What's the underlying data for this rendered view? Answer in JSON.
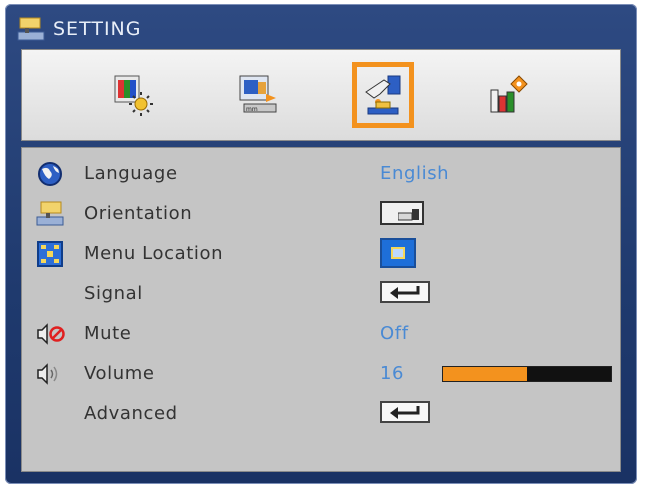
{
  "window": {
    "title": "SETTING",
    "title_icon": "projector-setting-icon"
  },
  "tabs": [
    {
      "icon": "image-settings-icon",
      "active": false
    },
    {
      "icon": "display-settings-icon",
      "active": false
    },
    {
      "icon": "setup-hand-icon",
      "active": true
    },
    {
      "icon": "options-bars-icon",
      "active": false
    }
  ],
  "menu": {
    "language": {
      "label": "Language",
      "value": "English",
      "icon": "globe-icon"
    },
    "orientation": {
      "label": "Orientation",
      "icon": "projector-orientation-icon",
      "value_icon": "front-projection-icon"
    },
    "menu_location": {
      "label": "Menu Location",
      "icon": "menu-location-icon",
      "value_icon": "center-location-icon"
    },
    "signal": {
      "label": "Signal",
      "value_icon": "enter-icon"
    },
    "mute": {
      "label": "Mute",
      "value": "Off",
      "icon": "mute-speaker-icon"
    },
    "volume": {
      "label": "Volume",
      "value": "16",
      "icon": "speaker-icon",
      "level": 0.5
    },
    "advanced": {
      "label": "Advanced",
      "value_icon": "enter-icon"
    }
  },
  "colors": {
    "accent_orange": "#f3921e",
    "value_blue": "#4a8ad4",
    "frame_blue": "#1f3a6e",
    "menu_gray": "#c5c5c5"
  }
}
